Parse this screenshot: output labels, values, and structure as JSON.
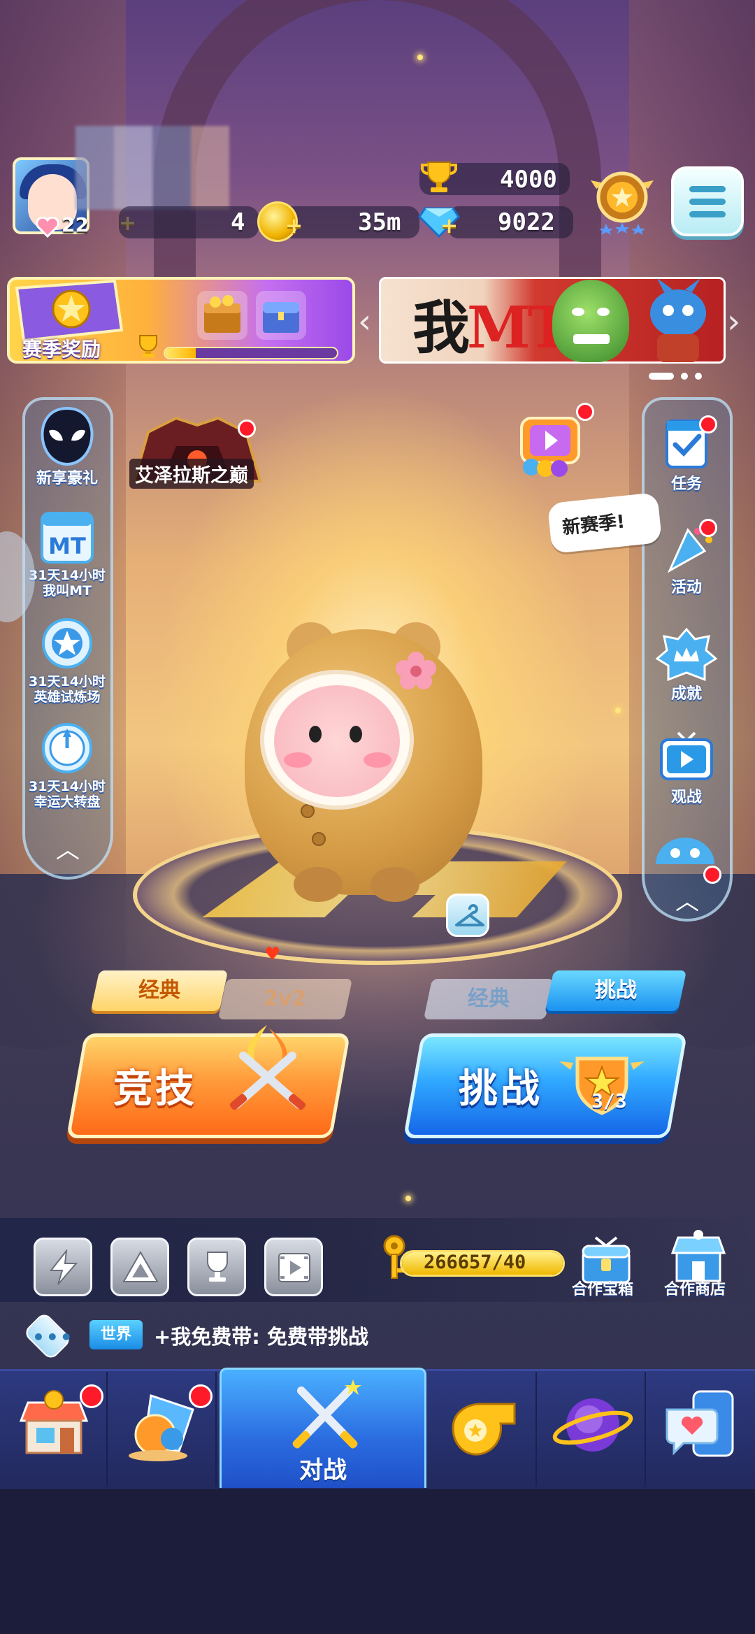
{
  "player": {
    "level": "22",
    "trophies": "4000",
    "energy": "4",
    "coins": "35m",
    "gems": "9022"
  },
  "season_reward": {
    "label": "赛季奖励",
    "progress": 0.18
  },
  "banner": {
    "text_main": "我",
    "text_accent": "MT",
    "page_count": 3,
    "active_page": 0
  },
  "left_panel": {
    "items": [
      {
        "label": "新享豪礼",
        "icon": "venom-icon"
      },
      {
        "timer": "31天14小时",
        "label": "我叫MT",
        "icon": "mt-calendar-icon"
      },
      {
        "timer": "31天14小时",
        "label": "英雄试炼场",
        "icon": "star-badge-icon"
      },
      {
        "timer": "31天14小时",
        "label": "幸运大转盘",
        "icon": "wheel-icon"
      }
    ]
  },
  "right_panel": {
    "items": [
      {
        "label": "任务",
        "icon": "checklist-icon"
      },
      {
        "label": "活动",
        "icon": "party-popper-icon"
      },
      {
        "label": "成就",
        "icon": "crown-icon"
      },
      {
        "label": "观战",
        "icon": "tv-play-icon"
      }
    ]
  },
  "boss_event": {
    "label": "艾泽拉斯之巅"
  },
  "speech_bubble": "新赛季!",
  "modes": {
    "left_tabs": [
      "经典",
      "2v2"
    ],
    "right_tabs": [
      "经典",
      "挑战"
    ],
    "compete_label": "竞技",
    "challenge_label": "挑战",
    "challenge_count": "3/3"
  },
  "toolbar": {
    "tools": [
      "lightning-icon",
      "triangle-icon",
      "trophy-cup-icon",
      "film-icon"
    ],
    "key_progress_text": "266657/40",
    "key_progress": 1.0,
    "coop_chest_label": "合作宝箱",
    "coop_shop_label": "合作商店"
  },
  "chat": {
    "channel": "世界",
    "message": "+我免费带: 免费带挑战"
  },
  "nav": {
    "items": [
      {
        "icon": "shop-icon",
        "badge": true
      },
      {
        "icon": "orb-bucket-icon",
        "badge": true
      },
      {
        "icon": "crossed-swords-icon",
        "label": "对战",
        "active": true
      },
      {
        "icon": "whistle-icon",
        "badge": false
      },
      {
        "icon": "planet-icon",
        "badge": false
      },
      {
        "icon": "chat-phone-icon",
        "badge": false
      }
    ]
  },
  "colors": {
    "compete": "#ff7a20",
    "challenge": "#2a8cf0",
    "badge_red": "#ff1a2a"
  }
}
